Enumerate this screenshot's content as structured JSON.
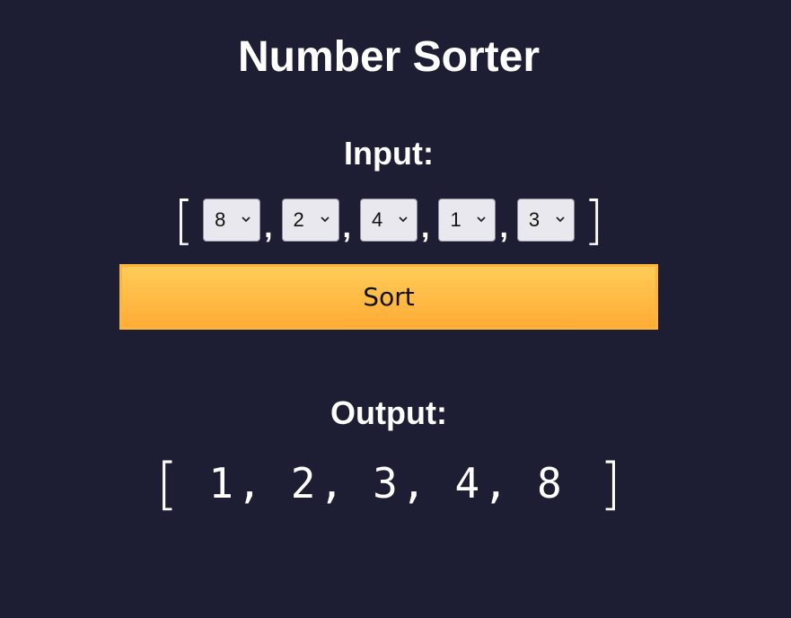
{
  "title": "Number Sorter",
  "input": {
    "label": "Input:",
    "open_bracket": "[",
    "close_bracket": "]",
    "separator": ",",
    "selects": [
      {
        "value": "8"
      },
      {
        "value": "2"
      },
      {
        "value": "4"
      },
      {
        "value": "1"
      },
      {
        "value": "3"
      }
    ]
  },
  "sort_button": {
    "label": "Sort"
  },
  "output": {
    "label": "Output:",
    "open_bracket": "[",
    "close_bracket": "]",
    "separator": ",",
    "values": [
      "1",
      "2",
      "3",
      "4",
      "8"
    ]
  },
  "icons": {
    "select_arrow": "chevron-down-icon"
  },
  "colors": {
    "background": "#1d1d33",
    "button_top": "#ffcc57",
    "button_bottom": "#ffac36",
    "select_bg": "#e9e8ee"
  }
}
